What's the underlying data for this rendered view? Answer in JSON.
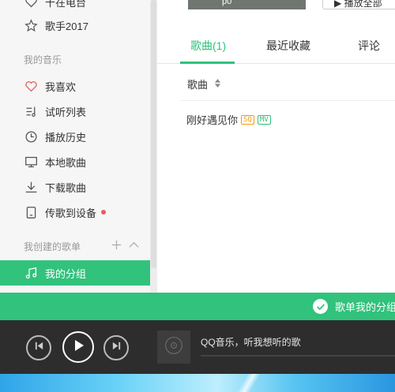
{
  "sidebar": {
    "top_items": [
      {
        "label": "千在电台",
        "icon": "heart-icon"
      },
      {
        "label": "歌手2017",
        "icon": "star-icon"
      }
    ],
    "my_music_title": "我的音乐",
    "my_music": [
      {
        "label": "我喜欢",
        "icon": "heart-icon"
      },
      {
        "label": "试听列表",
        "icon": "playlist-icon"
      },
      {
        "label": "播放历史",
        "icon": "clock-icon"
      },
      {
        "label": "本地歌曲",
        "icon": "monitor-icon"
      },
      {
        "label": "下载歌曲",
        "icon": "download-icon"
      },
      {
        "label": "传歌到设备",
        "icon": "device-icon"
      }
    ],
    "created_title": "我创建的歌单",
    "created_lists": [
      {
        "label": "我的分组",
        "icon": "music-note-icon"
      }
    ]
  },
  "main": {
    "thumb_text": "p0",
    "play_all_label": "▶ 播放全部",
    "tabs": [
      {
        "label": "歌曲(1)"
      },
      {
        "label": "最近收藏"
      },
      {
        "label": "评论"
      }
    ],
    "column_header": "歌曲",
    "songs": [
      {
        "title": "刚好遇见你",
        "badges": [
          "SQ",
          "MV"
        ]
      }
    ]
  },
  "toast": {
    "message": "歌单我的分组"
  },
  "player": {
    "status": "QQ音乐，听我想听的歌"
  },
  "colors": {
    "accent": "#31c27c",
    "player_bg": "#2d2d2d",
    "sidebar_bg": "#f6f6f6"
  }
}
